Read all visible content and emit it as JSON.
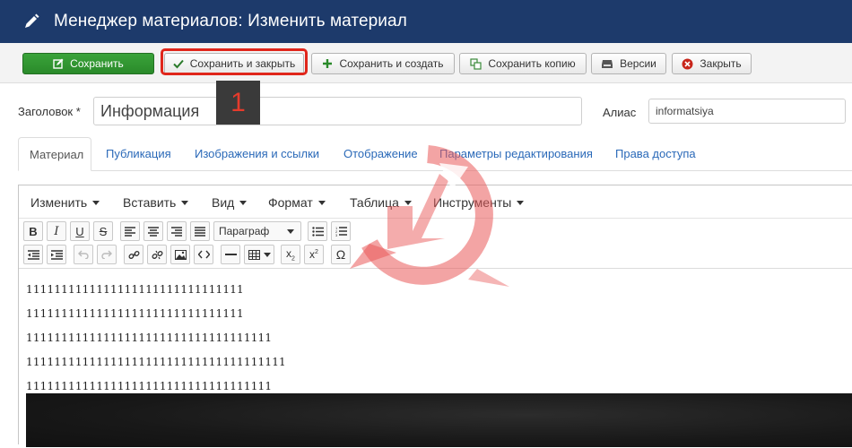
{
  "header": {
    "title": "Менеджер материалов: Изменить материал",
    "icon": "pencil-icon"
  },
  "toolbar": {
    "save": "Сохранить",
    "save_close": "Сохранить и закрыть",
    "save_new": "Сохранить и создать",
    "save_copy": "Сохранить копию",
    "versions": "Версии",
    "close": "Закрыть"
  },
  "annotation": {
    "step_number": "1"
  },
  "form": {
    "title_label": "Заголовок *",
    "title_value": "Информация",
    "alias_label": "Алиас",
    "alias_value": "informatsiya"
  },
  "tabs": [
    {
      "label": "Материал",
      "active": true
    },
    {
      "label": "Публикация"
    },
    {
      "label": "Изображения и ссылки"
    },
    {
      "label": "Отображение"
    },
    {
      "label": "Параметры редактирования"
    },
    {
      "label": "Права доступа"
    }
  ],
  "editor": {
    "menu": [
      "Изменить",
      "Вставить",
      "Вид",
      "Формат",
      "Таблица",
      "Инструменты"
    ],
    "paragraph_select": "Параграф",
    "lines": [
      "1111111111111111111111111111111",
      "1111111111111111111111111111111",
      "11111111111111111111111111111111111",
      "1111111111111111111111111111111111111",
      "11111111111111111111111111111111111"
    ],
    "toolbar_row1": [
      "bold",
      "italic",
      "underline",
      "strikethrough",
      "align-left",
      "align-center",
      "align-right",
      "align-justify",
      "bullet-list",
      "numbered-list"
    ],
    "toolbar_row2": [
      "outdent",
      "indent",
      "undo",
      "redo",
      "link",
      "unlink",
      "image",
      "code",
      "horizontal-rule",
      "table",
      "subscript",
      "superscript",
      "special-char"
    ]
  },
  "colors": {
    "header_bg": "#1d3a6b",
    "save_green": "#2e8f2e",
    "link_blue": "#2a69b8",
    "highlight_red": "#e0261b"
  }
}
